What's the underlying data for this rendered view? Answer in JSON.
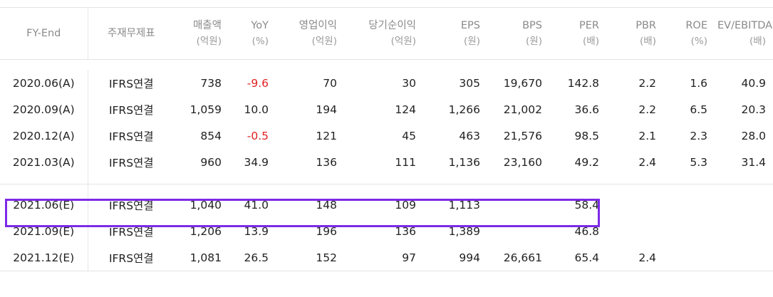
{
  "headers": [
    {
      "label": "FY-End",
      "unit": ""
    },
    {
      "label": "주재무제표",
      "unit": ""
    },
    {
      "label": "매출액",
      "unit": "(억원)"
    },
    {
      "label": "YoY",
      "unit": "(%)"
    },
    {
      "label": "영업이익",
      "unit": "(억원)"
    },
    {
      "label": "당기순이익",
      "unit": "(억원)"
    },
    {
      "label": "EPS",
      "unit": "(원)"
    },
    {
      "label": "BPS",
      "unit": "(원)"
    },
    {
      "label": "PER",
      "unit": "(배)"
    },
    {
      "label": "PBR",
      "unit": "(배)"
    },
    {
      "label": "ROE",
      "unit": "(%)"
    },
    {
      "label": "EV/EBITDA",
      "unit": "(배)"
    }
  ],
  "actual_rows": [
    [
      "2020.06(A)",
      "IFRS연결",
      "738",
      "-9.6",
      "70",
      "30",
      "305",
      "19,670",
      "142.8",
      "2.2",
      "1.6",
      "40.9"
    ],
    [
      "2020.09(A)",
      "IFRS연결",
      "1,059",
      "10.0",
      "194",
      "124",
      "1,266",
      "21,002",
      "36.6",
      "2.2",
      "6.5",
      "20.3"
    ],
    [
      "2020.12(A)",
      "IFRS연결",
      "854",
      "-0.5",
      "121",
      "45",
      "463",
      "21,576",
      "98.5",
      "2.1",
      "2.3",
      "28.0"
    ],
    [
      "2021.03(A)",
      "IFRS연결",
      "960",
      "34.9",
      "136",
      "111",
      "1,136",
      "23,160",
      "49.2",
      "2.4",
      "5.3",
      "31.4"
    ]
  ],
  "estimate_rows": [
    [
      "2021.06(E)",
      "IFRS연결",
      "1,040",
      "41.0",
      "148",
      "109",
      "1,113",
      "",
      "58.4",
      "",
      "",
      ""
    ],
    [
      "2021.09(E)",
      "IFRS연결",
      "1,206",
      "13.9",
      "196",
      "136",
      "1,389",
      "",
      "46.8",
      "",
      "",
      ""
    ],
    [
      "2021.12(E)",
      "IFRS연결",
      "1,081",
      "26.5",
      "152",
      "97",
      "994",
      "26,661",
      "65.4",
      "2.4",
      "",
      ""
    ]
  ],
  "highlight_color": "#7d2ae8",
  "negative_color": "#e02020"
}
